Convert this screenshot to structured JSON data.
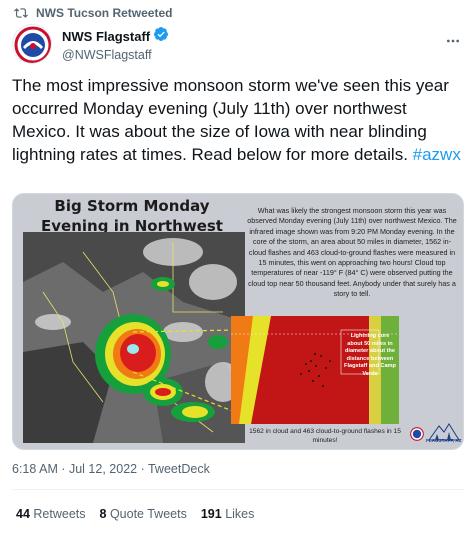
{
  "retweet": {
    "label": "NWS Tucson Retweeted",
    "icon": "retweet-icon"
  },
  "author": {
    "display_name": "NWS Flagstaff",
    "handle": "@NWSFlagstaff",
    "verified": true,
    "avatar_icon": "nws-logo-icon"
  },
  "tweet": {
    "text": "The most impressive monsoon storm we've seen this year occurred Monday evening (July 11th) over northwest Mexico. It was about the size of Iowa with near blinding lightning rates at times. Read below for more details. ",
    "hashtag": "#azwx"
  },
  "media": {
    "title": "Big Storm Monday Evening in Northwest Mexico",
    "description": "What was likely the strongest monsoon storm this year was observed Monday evening (July 11th) over northwest Mexico. The infrared image shown was from 9:20 PM Monday evening. In the core of the storm, an area about 50 miles in diameter, 1562 in-cloud flashes and 463 cloud-to-ground flashes were measured in 15 minutes, this went on approaching two hours! Cloud top temperatures of near -119° F (84° C) were observed putting the cloud top near 50 thousand feet. Anybody under that surely has a story to tell.",
    "zoom_label": "Lightning core about 50 miles in diameter about the distance between Flagstaff and Camp Verde",
    "zoom_caption": "1562 in cloud and 463 cloud-to-ground flashes in 15 minutes!",
    "brand": "FLAGSTAFF, AZ"
  },
  "timestamp": {
    "time": "6:18 AM",
    "date": "Jul 12, 2022",
    "source": "TweetDeck",
    "separator": " · "
  },
  "stats": [
    {
      "count": "44",
      "label": "Retweets"
    },
    {
      "count": "8",
      "label": "Quote Tweets"
    },
    {
      "count": "191",
      "label": "Likes"
    }
  ],
  "colors": {
    "accent": "#1d9bf0",
    "text": "#0f1419",
    "muted": "#536471"
  }
}
